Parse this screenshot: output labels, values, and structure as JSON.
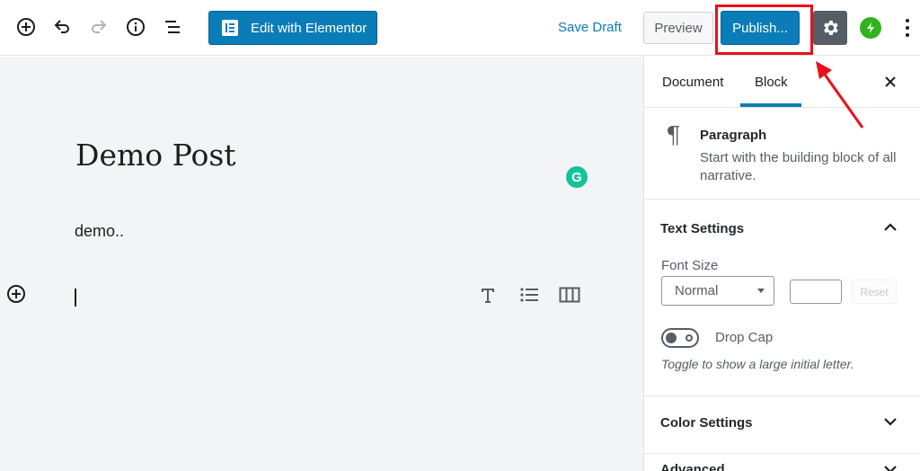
{
  "toolbar": {
    "elementor_label": "Edit with Elementor",
    "save_draft_label": "Save Draft",
    "preview_label": "Preview",
    "publish_label": "Publish..."
  },
  "editor": {
    "post_title": "Demo Post",
    "paragraph_text": "demo..",
    "grammarly_letter": "G"
  },
  "sidebar": {
    "tabs": [
      {
        "label": "Document",
        "active": false
      },
      {
        "label": "Block",
        "active": true
      }
    ],
    "block": {
      "name": "Paragraph",
      "description": "Start with the building block of all narrative."
    },
    "text_settings": {
      "title": "Text Settings",
      "font_size_label": "Font Size",
      "font_size_value": "Normal",
      "custom_size_value": "",
      "reset_label": "Reset",
      "drop_cap_label": "Drop Cap",
      "drop_cap_help": "Toggle to show a large initial letter."
    },
    "color_settings_title": "Color Settings",
    "advanced_title": "Advanced"
  },
  "colors": {
    "accent": "#0a7cb8",
    "highlight": "#e8101b",
    "jetpack": "#2fb41f",
    "grammarly": "#15c39a"
  },
  "icons": [
    "add-block-icon",
    "undo-icon",
    "redo-icon",
    "info-icon",
    "outline-icon",
    "elementor-icon",
    "gear-icon",
    "jetpack-icon",
    "more-vertical-icon",
    "grammarly-icon",
    "heading-icon",
    "list-icon",
    "columns-icon",
    "close-icon",
    "pilcrow-icon",
    "chevron-up-icon",
    "chevron-down-icon"
  ]
}
